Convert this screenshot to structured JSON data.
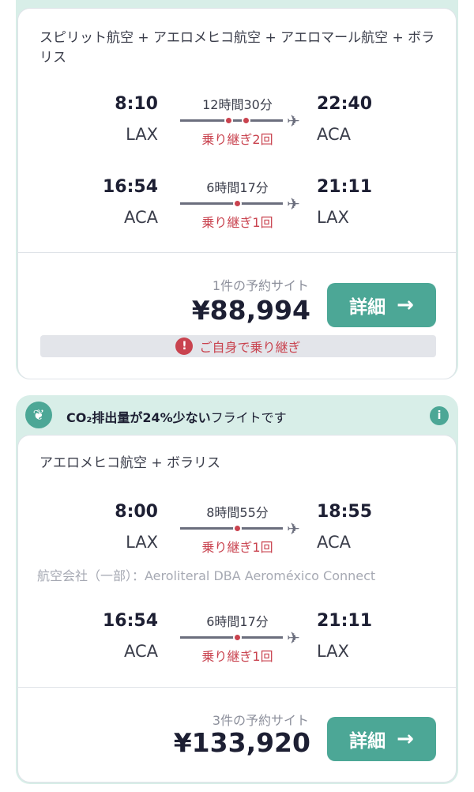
{
  "results": [
    {
      "airlines": "スピリット航空 + アエロメヒコ航空 + アエロマール航空 + ボラリス",
      "legs": [
        {
          "dep_time": "8:10",
          "dep_code": "LAX",
          "arr_time": "22:40",
          "arr_code": "ACA",
          "duration": "12時間30分",
          "stops": "乗り継ぎ2回"
        },
        {
          "dep_time": "16:54",
          "dep_code": "ACA",
          "arr_time": "21:11",
          "arr_code": "LAX",
          "duration": "6時間17分",
          "stops": "乗り継ぎ1回"
        }
      ],
      "booking_sites": "1件の予約サイト",
      "price": "¥88,994",
      "details_label": "詳細",
      "warning": "ご自身で乗り継ぎ"
    },
    {
      "eco_prefix": "CO₂排出量が24%少ない",
      "eco_suffix": "フライトです",
      "airlines": "アエロメヒコ航空 + ボラリス",
      "legs": [
        {
          "dep_time": "8:00",
          "dep_code": "LAX",
          "arr_time": "18:55",
          "arr_code": "ACA",
          "duration": "8時間55分",
          "stops": "乗り継ぎ1回"
        },
        {
          "dep_time": "16:54",
          "dep_code": "ACA",
          "arr_time": "21:11",
          "arr_code": "LAX",
          "duration": "6時間17分",
          "stops": "乗り継ぎ1回"
        }
      ],
      "operated_by": "航空会社（一部）：Aeroliteral DBA Aeroméxico Connect",
      "booking_sites": "3件の予約サイト",
      "price": "¥133,920",
      "details_label": "詳細"
    }
  ],
  "icons": {
    "plane": "airplane-icon",
    "arrow": "arrow-right-icon",
    "warning": "exclamation-circle-icon",
    "leaf": "leaf-icon",
    "info": "info-icon"
  },
  "colors": {
    "accent": "#4ca796",
    "stop_red": "#c9434f",
    "eco_bg": "#d8eee8"
  }
}
